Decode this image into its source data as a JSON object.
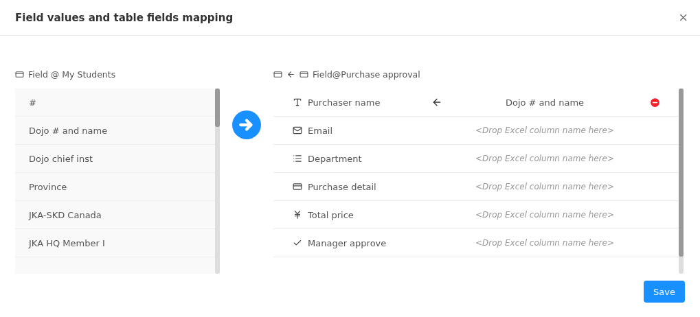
{
  "dialog": {
    "title": "Field values and table fields mapping",
    "close": "×"
  },
  "source": {
    "title": "Field @ My Students",
    "items": [
      {
        "label": "#"
      },
      {
        "label": "Dojo # and name"
      },
      {
        "label": "Dojo chief inst"
      },
      {
        "label": "Province"
      },
      {
        "label": "JKA-SKD Canada"
      },
      {
        "label": "JKA HQ Member I"
      }
    ]
  },
  "target": {
    "title": "Field@Purchase approval",
    "rows": [
      {
        "kind": "text",
        "name": "Purchaser name",
        "mapped": "Dojo # and name"
      },
      {
        "kind": "email",
        "name": "Email",
        "placeholder": "<Drop Excel column name here>"
      },
      {
        "kind": "list",
        "name": "Department",
        "placeholder": "<Drop Excel column name here>"
      },
      {
        "kind": "detail",
        "name": "Purchase detail",
        "placeholder": "<Drop Excel column name here>"
      },
      {
        "kind": "currency",
        "name": "Total price",
        "placeholder": "<Drop Excel column name here>"
      },
      {
        "kind": "check",
        "name": "Manager approve",
        "placeholder": "<Drop Excel column name here>"
      }
    ]
  },
  "buttons": {
    "save": "Save"
  }
}
